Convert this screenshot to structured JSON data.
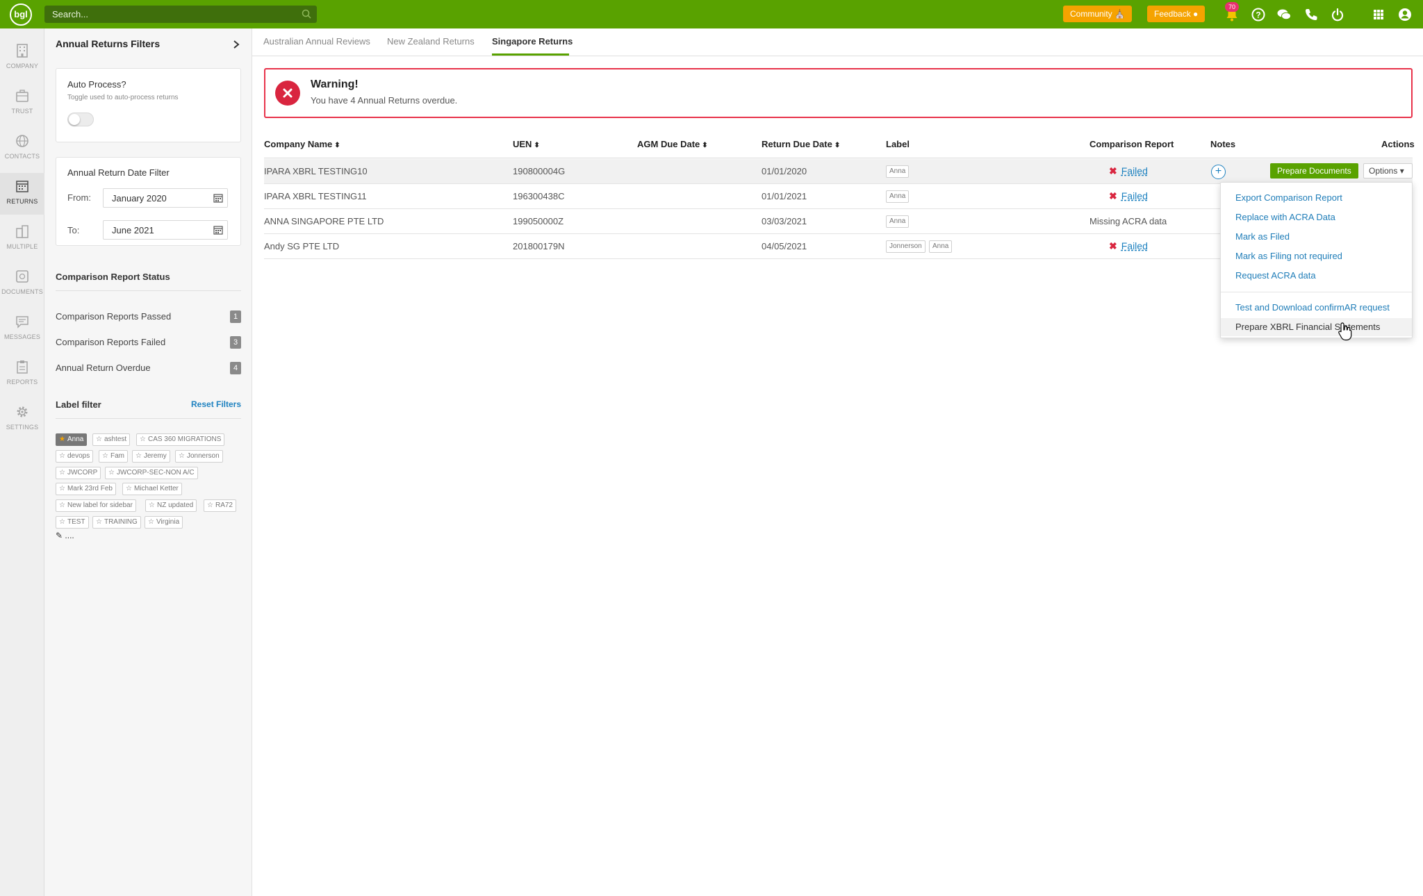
{
  "topbar": {
    "logo": "bgl",
    "search_placeholder": "Search...",
    "community_label": "Community",
    "feedback_label": "Feedback",
    "notification_count": "70",
    "icons": [
      "bell-icon",
      "help-icon",
      "chat-icon",
      "phone-icon",
      "power-icon",
      "apps-grid-icon",
      "user-icon"
    ],
    "brand_color": "#59a200",
    "accent_color": "#f5a300"
  },
  "leftnav": {
    "items": [
      {
        "label": "COMPANY",
        "icon": "building-icon"
      },
      {
        "label": "TRUST",
        "icon": "briefcase-icon"
      },
      {
        "label": "CONTACTS",
        "icon": "globe-icon"
      },
      {
        "label": "RETURNS",
        "icon": "calendar-icon"
      },
      {
        "label": "MULTIPLE",
        "icon": "buildings-icon"
      },
      {
        "label": "DOCUMENTS",
        "icon": "documents-icon"
      },
      {
        "label": "MESSAGES",
        "icon": "messages-icon"
      },
      {
        "label": "REPORTS",
        "icon": "clipboard-icon"
      },
      {
        "label": "SETTINGS",
        "icon": "gear-icon"
      }
    ],
    "active": "RETURNS"
  },
  "filters": {
    "title": "Annual Returns Filters",
    "auto_process": {
      "title": "Auto Process?",
      "hint": "Toggle used to auto-process returns",
      "enabled": false
    },
    "date_filter": {
      "title": "Annual Return Date Filter",
      "from_label": "From:",
      "from_value": "January 2020",
      "to_label": "To:",
      "to_value": "June 2021"
    },
    "status": {
      "title": "Comparison Report Status",
      "items": [
        {
          "label": "Comparison Reports Passed",
          "count": "1"
        },
        {
          "label": "Comparison Reports Failed",
          "count": "3"
        },
        {
          "label": "Annual Return Overdue",
          "count": "4"
        }
      ]
    },
    "label_filter": {
      "title": "Label filter",
      "reset_label": "Reset Filters",
      "tags": [
        {
          "label": "Anna",
          "selected": true
        },
        {
          "label": "ashtest",
          "selected": false
        },
        {
          "label": "CAS 360 MIGRATIONS",
          "selected": false
        },
        {
          "label": "devops",
          "selected": false
        },
        {
          "label": "Fam",
          "selected": false
        },
        {
          "label": "Jeremy",
          "selected": false
        },
        {
          "label": "Jonnerson",
          "selected": false
        },
        {
          "label": "JWCORP",
          "selected": false
        },
        {
          "label": "JWCORP-SEC-NON A/C",
          "selected": false
        },
        {
          "label": "Mark 23rd Feb",
          "selected": false
        },
        {
          "label": "Michael Ketter",
          "selected": false
        },
        {
          "label": "New label for sidebar",
          "selected": false
        },
        {
          "label": "NZ updated",
          "selected": false
        },
        {
          "label": "RA72",
          "selected": false
        },
        {
          "label": "TEST",
          "selected": false
        },
        {
          "label": "TRAINING",
          "selected": false
        },
        {
          "label": "Virginia",
          "selected": false
        }
      ],
      "more_label": "...."
    }
  },
  "tabs": [
    {
      "label": "Australian Annual Reviews",
      "active": false
    },
    {
      "label": "New Zealand Returns",
      "active": false
    },
    {
      "label": "Singapore Returns",
      "active": true
    }
  ],
  "warning": {
    "title": "Warning!",
    "message": "You have 4 Annual Returns overdue."
  },
  "table": {
    "columns": [
      "Company Name",
      "UEN",
      "AGM Due Date",
      "Return Due Date",
      "Label",
      "Comparison Report",
      "Notes",
      "Actions"
    ],
    "rows": [
      {
        "company": "IPARA XBRL TESTING10",
        "uen": "190800004G",
        "agm_due": "",
        "return_due": "01/01/2020",
        "labels": [
          "Anna"
        ],
        "report": "Failed",
        "report_status": "failed"
      },
      {
        "company": "IPARA XBRL TESTING11",
        "uen": "196300438C",
        "agm_due": "",
        "return_due": "01/01/2021",
        "labels": [
          "Anna"
        ],
        "report": "Failed",
        "report_status": "failed"
      },
      {
        "company": "ANNA SINGAPORE PTE LTD",
        "uen": "199050000Z",
        "agm_due": "",
        "return_due": "03/03/2021",
        "labels": [
          "Anna"
        ],
        "report": "Missing ACRA data",
        "report_status": "missing"
      },
      {
        "company": "Andy SG PTE LTD",
        "uen": "201800179N",
        "agm_due": "",
        "return_due": "04/05/2021",
        "labels": [
          "Jonnerson",
          "Anna"
        ],
        "report": "Failed",
        "report_status": "failed"
      }
    ],
    "prepare_label": "Prepare Documents",
    "options_label": "Options"
  },
  "options_menu": {
    "items": [
      "Export Comparison Report",
      "Replace with ACRA Data",
      "Mark as Filed",
      "Mark as Filing not required",
      "Request ACRA data",
      "Test and Download confirmAR request",
      "Prepare XBRL Financial Statements"
    ],
    "hovered": "Prepare XBRL Financial Statements"
  }
}
